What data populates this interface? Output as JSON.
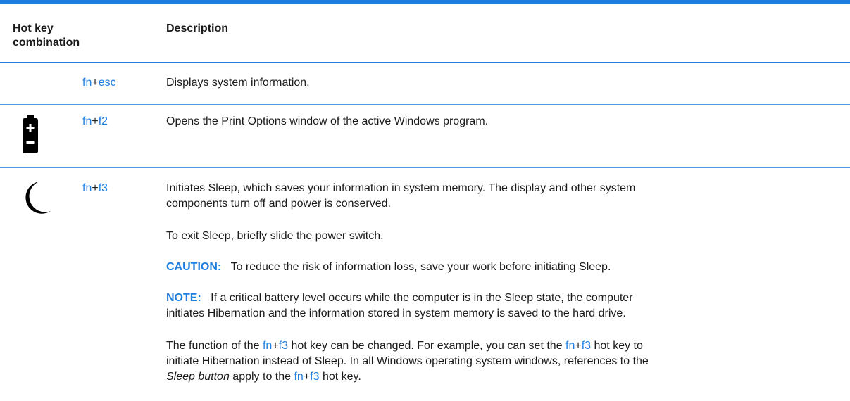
{
  "header": {
    "col1_line1": "Hot key",
    "col1_line2": "combination",
    "col2": "Description"
  },
  "rows": [
    {
      "key_a": "fn",
      "key_plus": "+",
      "key_b": "esc",
      "description": "Displays system information."
    },
    {
      "icon": "battery-icon",
      "key_a": "fn",
      "key_plus": "+",
      "key_b": "f2",
      "description": "Opens the Print Options window of the active Windows program."
    },
    {
      "icon": "moon-icon",
      "key_a": "fn",
      "key_plus": "+",
      "key_b": "f3",
      "p1_line1": "Initiates Sleep, which saves your information in system memory. The display and other system",
      "p1_line2": "components turn off and power is conserved.",
      "p2": "To exit Sleep, briefly slide the power switch.",
      "caution_label": "CAUTION:",
      "caution_text": "To reduce the risk of information loss, save your work before initiating Sleep.",
      "note_label": "NOTE:",
      "note_text_line1": "If a critical battery level occurs while the computer is in the Sleep state, the computer",
      "note_text_line2": "initiates Hibernation and the information stored in system memory is saved to the hard drive.",
      "p5": {
        "t1": "The function of the ",
        "k1a": "fn",
        "plus": "+",
        "k1b": "f3",
        "t2": " hot key can be changed. For example, you can set the ",
        "t3": " hot key to",
        "line2": "initiate Hibernation instead of Sleep. In all Windows operating system windows, references to the",
        "italic": "Sleep button",
        "t4": " apply to the ",
        "t5": " hot key."
      }
    }
  ],
  "colors": {
    "accent": "#1f7fe0"
  }
}
